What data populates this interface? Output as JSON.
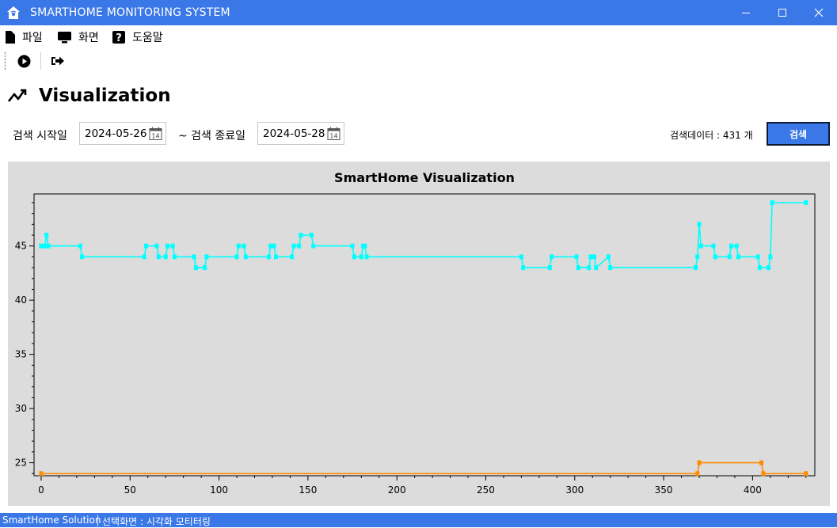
{
  "window": {
    "title": "SMARTHOME MONITORING SYSTEM"
  },
  "menu": [
    {
      "label": "파일",
      "icon": "file-icon"
    },
    {
      "label": "화면",
      "icon": "monitor-icon"
    },
    {
      "label": "도움말",
      "icon": "help-icon"
    }
  ],
  "toolbar": {
    "buttons": [
      "play-circle-icon",
      "sign-out-icon"
    ]
  },
  "page": {
    "title": "Visualization",
    "icon": "trend-chart-icon"
  },
  "search": {
    "start_label": "검색 시작일",
    "start_date": "2024-05-26",
    "end_label": "~ 검색 종료일",
    "end_date": "2024-05-28",
    "calendar_day": "14",
    "result_count": "검색데이터 : 431 개",
    "button_label": "검색"
  },
  "statusbar": {
    "app": "SmartHome Solution",
    "screen": "선택화면 : 시각화 모티터링"
  },
  "colors": {
    "accent": "#3b78e7",
    "humidity_series": "#00ffff",
    "temperature_series": "#ff8c00",
    "plot_bg": "#dcdcdc"
  },
  "chart_data": {
    "type": "line",
    "title": "SmartHome Visualization",
    "xlim": [
      -4,
      435
    ],
    "ylim": [
      23.8,
      49.8
    ],
    "xticks": [
      0,
      50,
      100,
      150,
      200,
      250,
      300,
      350,
      400
    ],
    "yticks": [
      25,
      30,
      35,
      40,
      45
    ],
    "grid": false,
    "series": [
      {
        "color": "#00ffff",
        "x": [
          0,
          2,
          3,
          4,
          22,
          23,
          58,
          59,
          65,
          66,
          70,
          71,
          74,
          75,
          86,
          87,
          92,
          93,
          110,
          111,
          114,
          115,
          128,
          129,
          131,
          132,
          141,
          142,
          145,
          146,
          152,
          153,
          175,
          176,
          180,
          181,
          182,
          183,
          270,
          271,
          286,
          287,
          301,
          302,
          308,
          309,
          311,
          312,
          319,
          320,
          368,
          369,
          370,
          371,
          378,
          379,
          387,
          388,
          391,
          392,
          403,
          404,
          409,
          410,
          411,
          430
        ],
        "y": [
          45,
          45,
          46,
          45,
          45,
          44,
          44,
          45,
          45,
          44,
          44,
          45,
          45,
          44,
          44,
          43,
          43,
          44,
          44,
          45,
          45,
          44,
          44,
          45,
          45,
          44,
          44,
          45,
          45,
          46,
          46,
          45,
          45,
          44,
          44,
          45,
          45,
          44,
          44,
          43,
          43,
          44,
          44,
          43,
          43,
          44,
          44,
          43,
          44,
          43,
          43,
          44,
          47,
          45,
          45,
          44,
          44,
          45,
          45,
          44,
          44,
          43,
          43,
          44,
          49,
          49
        ]
      },
      {
        "color": "#ff8c00",
        "x": [
          0,
          369,
          370,
          405,
          406,
          430
        ],
        "y": [
          24,
          24,
          25,
          25,
          24,
          24
        ]
      }
    ]
  }
}
